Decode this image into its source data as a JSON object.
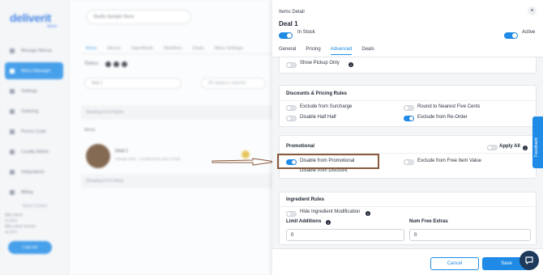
{
  "sidebar": {
    "logo": "deliverit",
    "logo_sub": "4ever",
    "items": [
      {
        "label": "Manage Menus",
        "active": false
      },
      {
        "label": "Menu Manager",
        "active": true
      },
      {
        "label": "Settings",
        "active": false
      },
      {
        "label": "Ordering",
        "active": false
      },
      {
        "label": "Promo Code",
        "active": false
      },
      {
        "label": "Loyalty Admin",
        "active": false
      },
      {
        "label": "Integrations",
        "active": false
      },
      {
        "label": "Billing",
        "active": false
      }
    ],
    "sub_item": "Stock Control",
    "footer_lines": [
      "Billy Admin",
      "v2.26.0",
      "Billy Latest Version",
      "v2.26.0"
    ],
    "logout_label": "Log out"
  },
  "main": {
    "store_select": "Studio Sample Store",
    "tabs": [
      "Items",
      "Menus",
      "Ingredients",
      "Modifiers",
      "Deals",
      "Menu Settings"
    ],
    "active_tab": "Items",
    "status_label": "Status:",
    "search_value": "deal 1",
    "filter_placeholder": "All category selected",
    "showing_top": "Showing 8 of 9 items",
    "items_label": "Items",
    "deal_name": "Deal 1",
    "deal_desc": "Sample deal - 1 Small Pizza and 1 Drink",
    "showing_bottom": "Showing 8 of 9 items"
  },
  "panel": {
    "header_label": "Items Detail",
    "close_icon": "×",
    "title": "Deal 1",
    "in_stock_label": "In Stock",
    "in_stock": true,
    "active_label": "Active",
    "active": true,
    "tabs": [
      "General",
      "Pricing",
      "Advanced",
      "Deals"
    ],
    "active_tab": "Advanced",
    "show_pickup_only": {
      "label": "Show Pickup Only",
      "on": false
    },
    "discounts": {
      "heading": "Discounts & Pricing Rules",
      "exclude_surcharge": {
        "label": "Exclude from Surcharge",
        "on": false
      },
      "round_five_cents": {
        "label": "Round to Nearest Five Cents",
        "on": false
      },
      "disable_half_half": {
        "label": "Disable Half Half",
        "on": false
      },
      "exclude_reorder": {
        "label": "Exclude from Re-Order",
        "on": true
      }
    },
    "promotional": {
      "heading": "Promotional",
      "apply_all_label": "Apply All",
      "apply_all": false,
      "disable_promotional": {
        "label": "Disable from Promotional",
        "on": true
      },
      "exclude_free_item": {
        "label": "Exclude from Free Item Value",
        "on": false
      },
      "disable_discount": {
        "label": "Disable from Discount",
        "on": false
      }
    },
    "ingredients": {
      "heading": "Ingredient Rules",
      "hide_modification": {
        "label": "Hide Ingredient Modification",
        "on": false
      },
      "limit_additions_label": "Limit Additions",
      "limit_additions_value": "0",
      "num_free_extras_label": "Num Free Extras",
      "num_free_extras_value": "0"
    },
    "cancel_label": "Cancel",
    "save_label": "Save"
  },
  "feedback_label": "Feedback",
  "colors": {
    "accent": "#1f8be6",
    "annotation": "#8a5a3c"
  }
}
